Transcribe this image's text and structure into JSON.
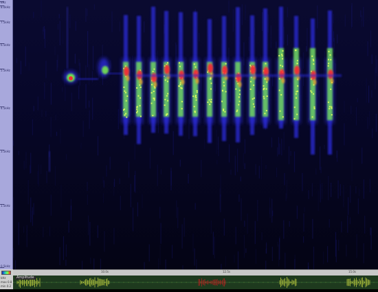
{
  "frequency_axis": {
    "ticks": [
      "kHz",
      "8.0kHz",
      "7.5kHz",
      "6.5kHz",
      "5.5kHz",
      "4.5kHz",
      "3.5kHz",
      "1.5kHz",
      "0.5kHz"
    ]
  },
  "time_axis": {
    "labels": [
      "10.0s",
      "12.5s",
      "15.0s"
    ]
  },
  "amplitude_panel": {
    "label": "Amplitude",
    "side_labels": [
      "kHz",
      "max 0.8",
      "min 0.2"
    ]
  },
  "colors": {
    "ruler_bg": "#a8a8dc",
    "spectrogram_bg": "#050518",
    "amplitude_bg": "#1e3a1e",
    "low_energy": "#2a2ad8",
    "mid_energy": "#80ff40",
    "high_energy": "#ff2030",
    "amplitude_trace": "#c8d840",
    "selection_trace": "#c02020"
  }
}
